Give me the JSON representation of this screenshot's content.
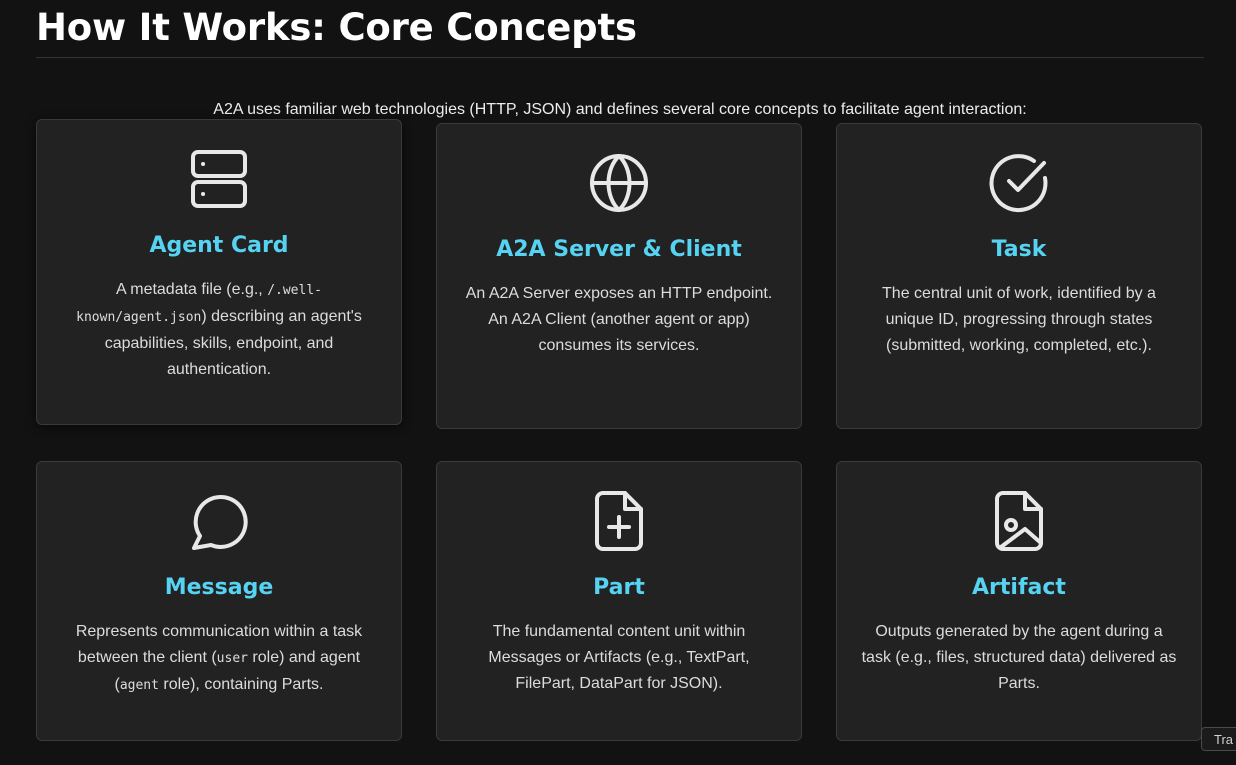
{
  "header": {
    "title": "How It Works: Core Concepts",
    "intro": "A2A uses familiar web technologies (HTTP, JSON) and defines several core concepts to facilitate agent interaction:"
  },
  "cards": [
    {
      "icon": "server-icon",
      "title": "Agent Card",
      "desc": {
        "p1": "A metadata file (e.g., ",
        "code1": "/.well-known/agent.json",
        "p2": ") describing an agent's capabilities, skills, endpoint, and authentication."
      }
    },
    {
      "icon": "globe-icon",
      "title": "A2A Server & Client",
      "desc": "An A2A Server exposes an HTTP endpoint. An A2A Client (another agent or app) consumes its services."
    },
    {
      "icon": "check-circle-icon",
      "title": "Task",
      "desc": "The central unit of work, identified by a unique ID, progressing through states (submitted, working, completed, etc.)."
    },
    {
      "icon": "message-circle-icon",
      "title": "Message",
      "desc": {
        "p1": "Represents communication within a task between the client (",
        "code1": "user",
        "p2": " role) and agent (",
        "code2": "agent",
        "p3": " role), containing Parts."
      }
    },
    {
      "icon": "file-plus-icon",
      "title": "Part",
      "desc": "The fundamental content unit within Messages or Artifacts (e.g., TextPart, FilePart, DataPart for JSON)."
    },
    {
      "icon": "file-image-icon",
      "title": "Artifact",
      "desc": "Outputs generated by the agent during a task (e.g., files, structured data) delivered as Parts."
    }
  ],
  "tooltip": {
    "text": "Tra"
  },
  "colors": {
    "background": "#121212",
    "card": "#222222",
    "accent": "#56d3f2",
    "text": "#dcdcdc"
  }
}
